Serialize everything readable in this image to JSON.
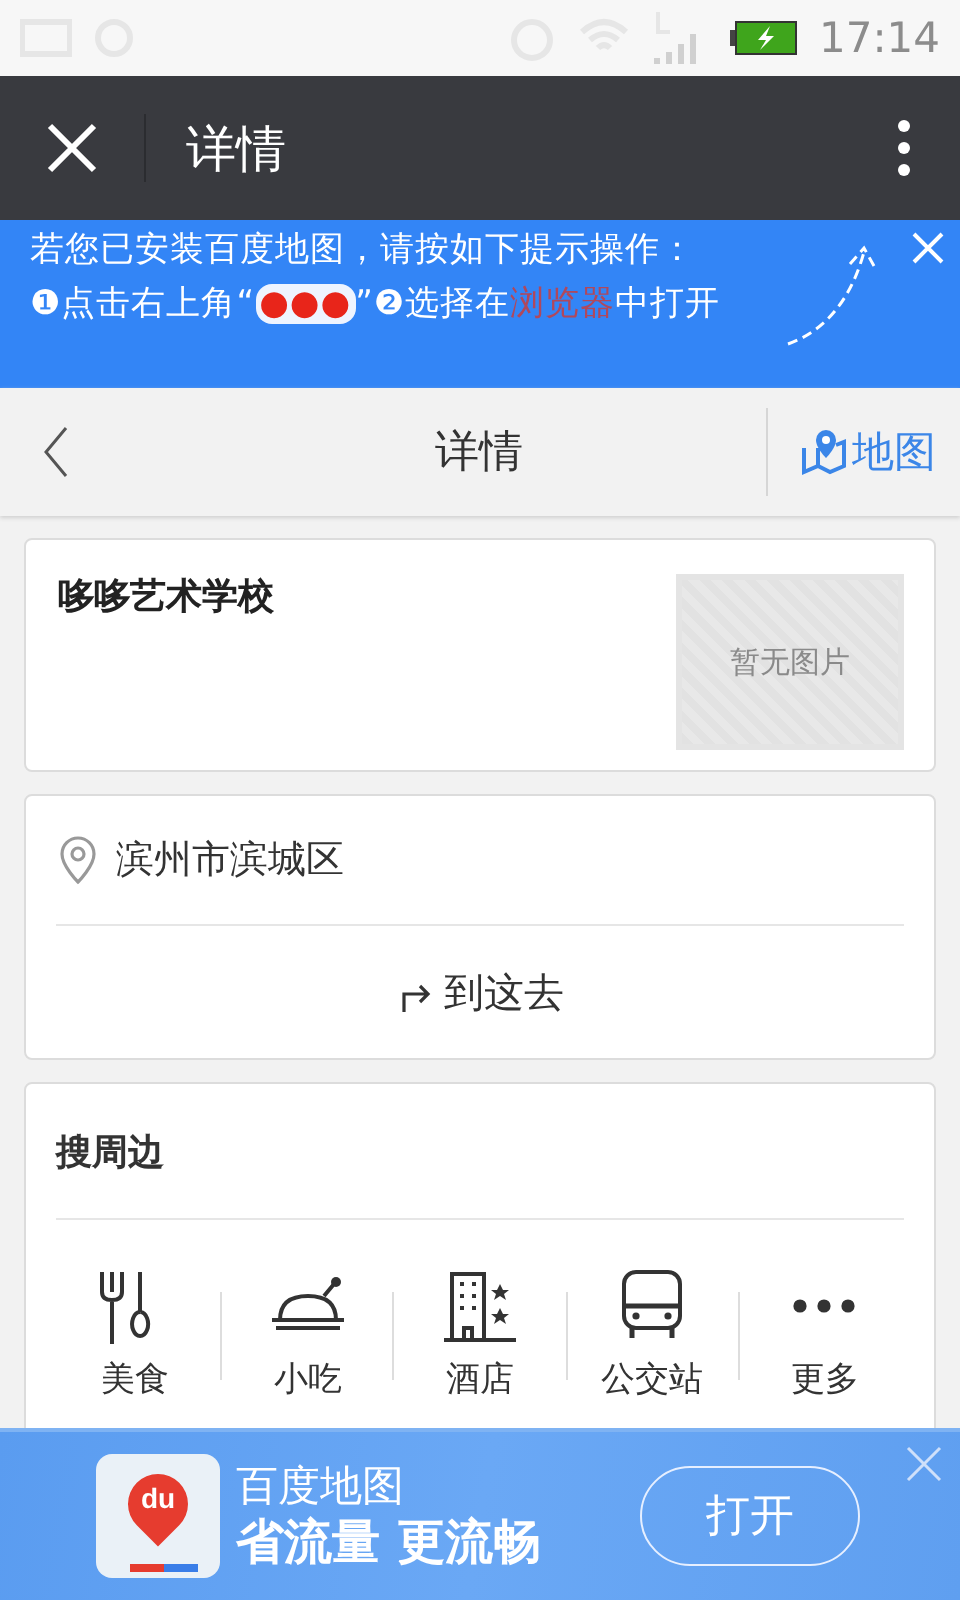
{
  "status_bar": {
    "time": "17:14"
  },
  "title_bar": {
    "title": "详情"
  },
  "hint": {
    "line": "若您已安装百度地图，请按如下提示操作：",
    "steps": [
      {
        "kind": "plain",
        "text": "❶点击右上角“"
      },
      {
        "kind": "dots",
        "text": "●●●"
      },
      {
        "kind": "plain",
        "text": "”❷选择在"
      },
      {
        "kind": "link",
        "text": "浏览器"
      },
      {
        "kind": "plain",
        "text": "中打开"
      }
    ]
  },
  "sub_header": {
    "title": "详情",
    "map_button": "地图"
  },
  "place": {
    "name": "哆哆艺术学校",
    "photo_placeholder": "暂无图片"
  },
  "address": {
    "text": "滨州市滨城区",
    "go_button": "到这去"
  },
  "nearby": {
    "title": "搜周边",
    "items": [
      {
        "kind": "food",
        "label": "美食"
      },
      {
        "kind": "snack",
        "label": "小吃"
      },
      {
        "kind": "hotel",
        "label": "酒店"
      },
      {
        "kind": "bus",
        "label": "公交站"
      },
      {
        "kind": "more",
        "label": "更多"
      }
    ]
  },
  "app_banner": {
    "icon_text": "du",
    "name": "百度地图",
    "slogan": "省流量 更流畅",
    "open_button": "打开"
  }
}
